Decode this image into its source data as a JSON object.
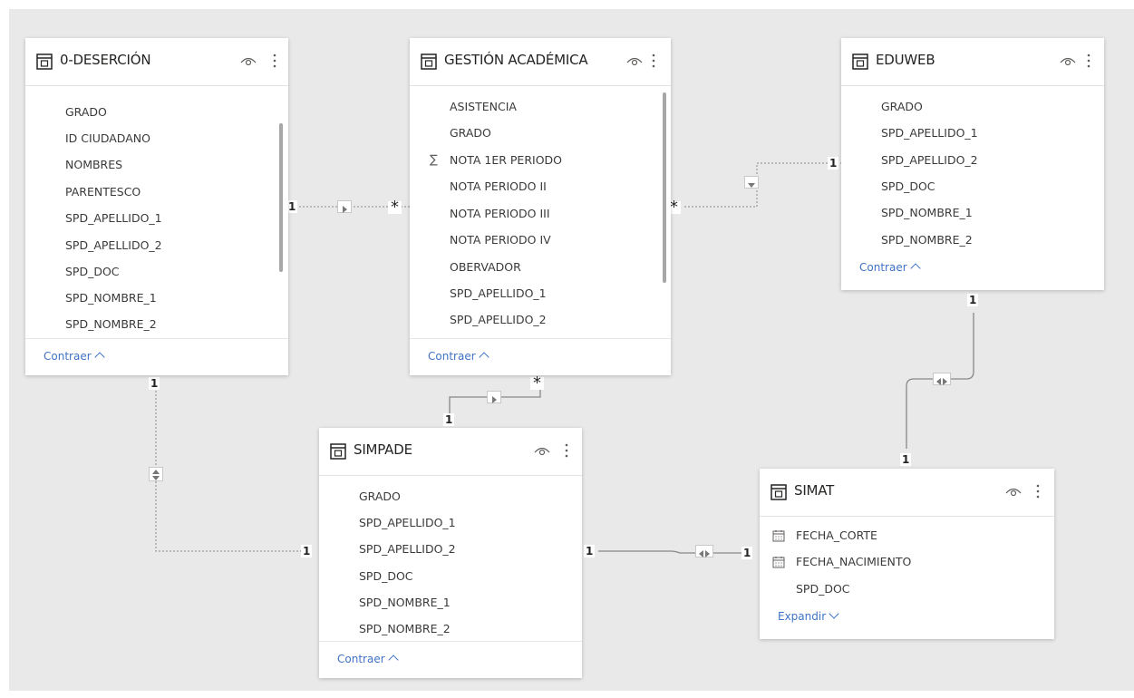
{
  "tables": {
    "desercion": {
      "title": "0-DESERCIÓN",
      "fields": [
        "GRADO",
        "ID CIUDADANO",
        "NOMBRES",
        "PARENTESCO",
        "SPD_APELLIDO_1",
        "SPD_APELLIDO_2",
        "SPD_DOC",
        "SPD_NOMBRE_1",
        "SPD_NOMBRE_2"
      ],
      "footer": "Contraer"
    },
    "gestion": {
      "title": "GESTIÓN ACADÉMICA",
      "fields": [
        "ASISTENCIA",
        "GRADO",
        "NOTA 1ER PERIODO",
        "NOTA PERIODO II",
        "NOTA PERIODO III",
        "NOTA PERIODO IV",
        "OBERVADOR",
        "SPD_APELLIDO_1",
        "SPD_APELLIDO_2"
      ],
      "sum_icon": "∑",
      "footer": "Contraer"
    },
    "eduweb": {
      "title": "EDUWEB",
      "fields": [
        "GRADO",
        "SPD_APELLIDO_1",
        "SPD_APELLIDO_2",
        "SPD_DOC",
        "SPD_NOMBRE_1",
        "SPD_NOMBRE_2"
      ],
      "footer": "Contraer"
    },
    "simpade": {
      "title": "SIMPADE",
      "fields": [
        "GRADO",
        "SPD_APELLIDO_1",
        "SPD_APELLIDO_2",
        "SPD_DOC",
        "SPD_NOMBRE_1",
        "SPD_NOMBRE_2"
      ],
      "footer": "Contraer"
    },
    "simat": {
      "title": "SIMAT",
      "fields": [
        "FECHA_CORTE",
        "FECHA_NACIMIENTO",
        "SPD_DOC"
      ],
      "footer": "Expandir"
    }
  },
  "cardinality": {
    "one": "1",
    "many": "*"
  },
  "icons": {
    "table": "table-icon",
    "visibility": "eye-icon",
    "more": "more-options-icon",
    "date": "calendar-icon"
  },
  "colors": {
    "canvas": "#e9e9e9",
    "link": "#4073c6",
    "line": "#8a8886"
  }
}
